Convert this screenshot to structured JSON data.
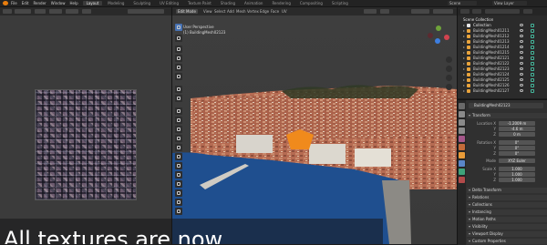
{
  "topbar": {
    "menus": [
      "File",
      "Edit",
      "Render",
      "Window",
      "Help"
    ],
    "tabs": [
      "Layout",
      "Modeling",
      "Sculpting",
      "UV Editing",
      "Texture Paint",
      "Shading",
      "Animation",
      "Rendering",
      "Compositing",
      "Scripting"
    ],
    "active_tab": "Layout",
    "scene": "Scene",
    "view_layer": "View Layer"
  },
  "viewport": {
    "mode": "Edit Mode",
    "menus": [
      "View",
      "Select",
      "Add",
      "Mesh",
      "Vertex",
      "Edge",
      "Face",
      "UV"
    ],
    "info_line1": "User Perspective",
    "info_line2": "(1) BuildingMesh02123"
  },
  "outliner": {
    "title": "Scene Collection",
    "collection": "Collection",
    "items": [
      "BuildingMesh01211",
      "BuildingMesh01212",
      "BuildingMesh01213",
      "BuildingMesh01214",
      "BuildingMesh01215",
      "BuildingMesh02121",
      "BuildingMesh02122",
      "BuildingMesh02123",
      "BuildingMesh02124",
      "BuildingMesh02125",
      "BuildingMesh02126",
      "BuildingMesh02127"
    ]
  },
  "properties": {
    "object_name": "BuildingMesh02123",
    "sections": {
      "transform": "Transform",
      "delta": "Delta Transform",
      "relations": "Relations",
      "collections": "Collections",
      "instancing": "Instancing",
      "motion_paths": "Motion Paths",
      "visibility": "Visibility",
      "viewport_display": "Viewport Display",
      "custom_props": "Custom Properties"
    },
    "location_label": "Location X",
    "rotation_label": "Rotation X",
    "mode_label": "Mode",
    "scale_label": "Scale X",
    "y_label": "Y",
    "z_label": "Z",
    "location": [
      "-1.2009 m",
      "-4.6 m",
      "0 m"
    ],
    "rotation": [
      "0°",
      "0°",
      "0°"
    ],
    "mode_value": "XYZ Euler",
    "scale": [
      "1.000",
      "1.000",
      "1.000"
    ]
  },
  "caption": "All textures are now"
}
